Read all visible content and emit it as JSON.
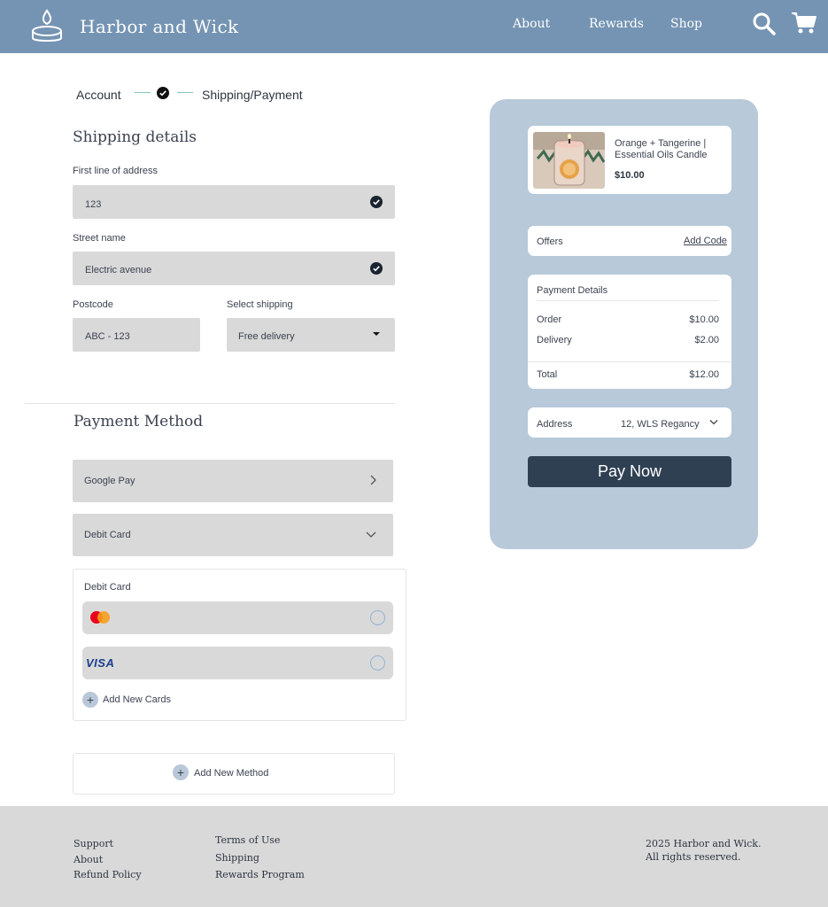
{
  "header": {
    "brand": "Harbor and Wick",
    "nav": {
      "about": "About",
      "rewards": "Rewards",
      "shop": "Shop"
    }
  },
  "steps": {
    "account": "Account",
    "shipping_payment": "Shipping/Payment"
  },
  "shipping": {
    "title": "Shipping details",
    "address_label": "First line of address",
    "address_value": "123",
    "street_label": "Street name",
    "street_value": "Electric avenue",
    "postcode_label": "Postcode",
    "postcode_value": "ABC - 123",
    "shipping_label": "Select shipping",
    "shipping_value": "Free delivery"
  },
  "payment": {
    "title": "Payment Method",
    "google_pay": "Google Pay",
    "debit_card": "Debit Card",
    "card_box_title": "Debit Card",
    "visa_label": "VISA",
    "add_new_cards": "Add New Cards",
    "add_new_method": "Add New Method"
  },
  "summary": {
    "product_name": "Orange + Tangerine | Essential Oils Candle",
    "product_price": "$10.00",
    "offers_label": "Offers",
    "add_code": "Add Code",
    "details_title": "Payment Details",
    "order_label": "Order",
    "order_value": "$10.00",
    "delivery_label": "Delivery",
    "delivery_value": "$2.00",
    "total_label": "Total",
    "total_value": "$12.00",
    "address_label": "Address",
    "address_value": "12, WLS Regancy",
    "pay_button": "Pay Now"
  },
  "footer": {
    "support": "Support",
    "about": "About",
    "refund": "Refund Policy",
    "terms": "Terms of Use",
    "shipping": "Shipping",
    "rewards": "Rewards Program",
    "copyright_line1": "2025 Harbor and Wick.",
    "copyright_line2": "All rights reserved."
  },
  "colors": {
    "header": "#7594b3",
    "panel": "#b8c9d9",
    "pay_button": "#2f4053",
    "field": "#d9d9d9",
    "footer": "#d9d9d9",
    "step_line": "#7fc4c4"
  },
  "icons": {
    "logo": "candle-icon",
    "search": "search-icon",
    "cart": "cart-icon",
    "check": "check-circle-icon",
    "dropdown": "caret-down-icon",
    "chevron_right": "chevron-right-icon",
    "chevron_down": "chevron-down-icon",
    "mastercard": "mastercard-icon",
    "plus": "plus-icon"
  }
}
